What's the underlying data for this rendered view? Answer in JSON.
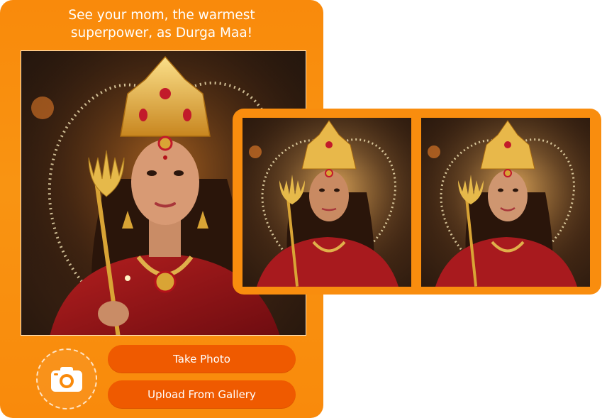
{
  "card": {
    "headline_line1": "See your mom, the warmest",
    "headline_line2": "superpower, as Durga Maa!"
  },
  "actions": {
    "take_photo_label": "Take Photo",
    "upload_label": "Upload From Gallery",
    "camera_icon": "camera-icon"
  },
  "colors": {
    "card_orange": "#f98a0b",
    "button_orange": "#ef5a00",
    "results_orange": "#f98d0e",
    "text_white": "#ffffff"
  },
  "images": {
    "main_portrait": "durga-portrait",
    "results": [
      "durga-result-1",
      "durga-result-2"
    ]
  }
}
